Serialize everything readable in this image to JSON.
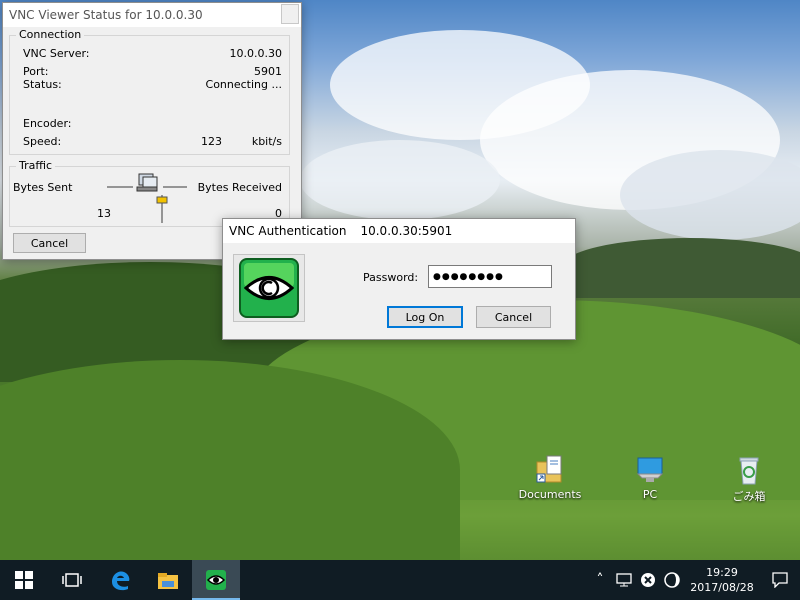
{
  "status_window": {
    "title": "VNC Viewer Status for 10.0.0.30",
    "connection": {
      "group_label": "Connection",
      "vnc_server_label": "VNC Server:",
      "vnc_server_value": "10.0.0.30",
      "port_label": "Port:",
      "port_value": "5901",
      "status_label": "Status:",
      "status_value": "Connecting ...",
      "encoder_label": "Encoder:",
      "encoder_value": "",
      "speed_label": "Speed:",
      "speed_value": "123",
      "speed_unit": "kbit/s"
    },
    "traffic": {
      "group_label": "Traffic",
      "bytes_sent_label": "Bytes Sent",
      "bytes_sent_value": "13",
      "bytes_received_label": "Bytes Received",
      "bytes_received_value": "0"
    },
    "cancel_label": "Cancel"
  },
  "auth_dialog": {
    "title": "VNC Authentication",
    "host": "10.0.0.30:5901",
    "password_label": "Password:",
    "password_value": "●●●●●●●●",
    "logon_label": "Log On",
    "cancel_label": "Cancel"
  },
  "desktop": {
    "icons": [
      {
        "label": "Documents"
      },
      {
        "label": "PC"
      },
      {
        "label": "ごみ箱"
      }
    ]
  },
  "taskbar": {
    "clock_time": "19:29",
    "clock_date": "2017/08/28"
  },
  "colors": {
    "accent": "#0078d7",
    "taskbar": "#101c24",
    "vnc_green": "#22b14c"
  }
}
